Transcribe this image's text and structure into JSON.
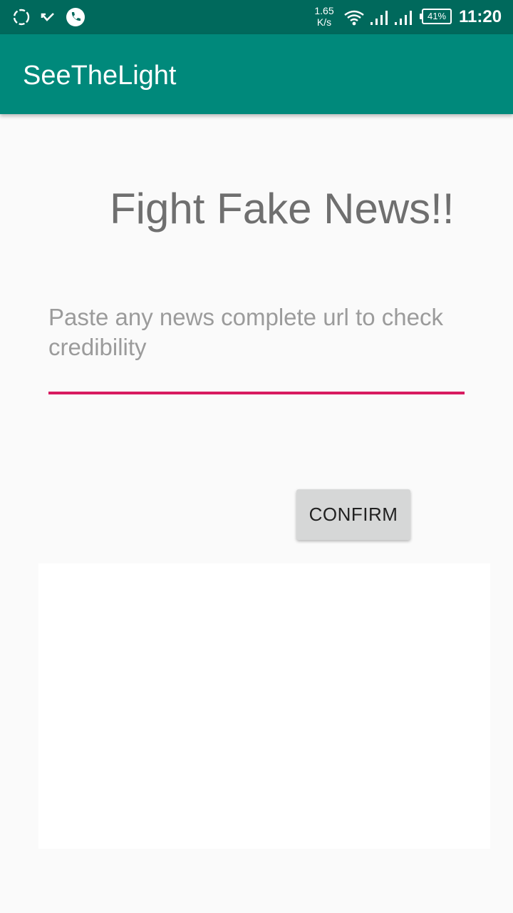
{
  "status_bar": {
    "icons": [
      "sync-icon",
      "missed-call-icon",
      "phone-icon",
      "wifi-icon",
      "signal-icon",
      "signal-icon",
      "battery-icon"
    ],
    "speed_value": "1.65",
    "speed_unit": "K/s",
    "battery": "41%",
    "time": "11:20",
    "color": "#00695c"
  },
  "app_bar": {
    "title": "SeeTheLight",
    "color": "#00897b"
  },
  "main": {
    "headline": "Fight Fake News!!",
    "url_input": {
      "placeholder": "Paste any news complete url to check credibility",
      "value": "",
      "accent": "#d81b60"
    },
    "confirm_label": "CONFIRM"
  }
}
